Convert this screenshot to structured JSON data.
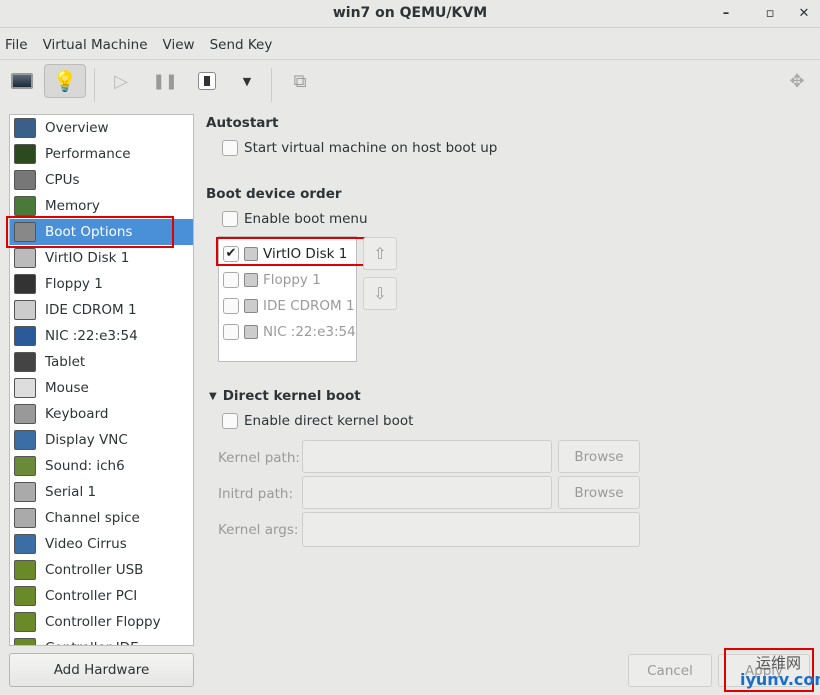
{
  "window": {
    "title": "win7 on QEMU/KVM",
    "minimize": "–",
    "maximize": "▫",
    "close": "✕"
  },
  "menu": [
    "File",
    "Virtual Machine",
    "View",
    "Send Key"
  ],
  "sidebar": {
    "items": [
      "Overview",
      "Performance",
      "CPUs",
      "Memory",
      "Boot Options",
      "VirtIO Disk 1",
      "Floppy 1",
      "IDE CDROM 1",
      "NIC :22:e3:54",
      "Tablet",
      "Mouse",
      "Keyboard",
      "Display VNC",
      "Sound: ich6",
      "Serial 1",
      "Channel spice",
      "Video Cirrus",
      "Controller USB",
      "Controller PCI",
      "Controller Floppy",
      "Controller IDE"
    ],
    "selected": "Boot Options",
    "add_hardware": "Add Hardware"
  },
  "autostart": {
    "heading": "Autostart",
    "checkbox": "Start virtual machine on host boot up",
    "checked": false
  },
  "boot": {
    "heading": "Boot device order",
    "enable_menu": "Enable boot menu",
    "devices": [
      {
        "label": "VirtIO Disk 1",
        "checked": true
      },
      {
        "label": "Floppy 1",
        "checked": false
      },
      {
        "label": "IDE CDROM 1",
        "checked": false
      },
      {
        "label": "NIC :22:e3:54",
        "checked": false
      }
    ],
    "up": "⇧",
    "down": "⇩"
  },
  "kernel": {
    "heading": "Direct kernel boot",
    "enable": "Enable direct kernel boot",
    "kernel_path": "Kernel path:",
    "initrd_path": "Initrd path:",
    "kernel_args": "Kernel args:",
    "browse": "Browse"
  },
  "footer": {
    "cancel": "Cancel",
    "apply": "Apply"
  },
  "watermark": {
    "cn": "运维网",
    "url": "iyunv.com"
  }
}
